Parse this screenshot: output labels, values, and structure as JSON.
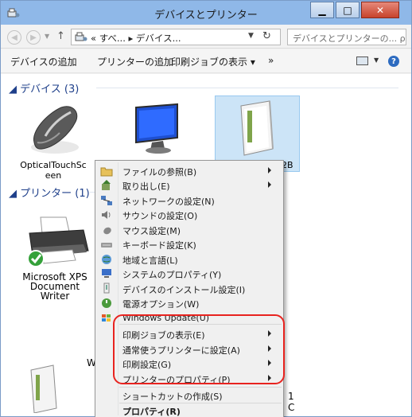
{
  "window": {
    "title": "デバイスとプリンター"
  },
  "nav": {
    "address_text": "« すべ... ▸ デバイス...",
    "search_placeholder": "デバイスとプリンターの... ρ"
  },
  "commands": {
    "add_device": "デバイスの追加",
    "add_printer": "プリンターの追加",
    "print_jobs": "印刷ジョブの表示 ▾",
    "more": "»"
  },
  "groups": {
    "devices": "◢ デバイス (3)",
    "printers": "◢ プリンター (1)"
  },
  "devices": [
    {
      "line1": "OpticalTouchSc",
      "line2": "een",
      "icon": "mouse-icon"
    },
    {
      "line1": "",
      "line2": "",
      "icon": "monitor-icon"
    },
    {
      "line1": "2B",
      "line2": "",
      "icon": "external-drive-icon"
    }
  ],
  "printers": [
    {
      "line1": "Microsoft XPS",
      "line2": "Document",
      "line3": "Writer",
      "icon": "printer-icon"
    }
  ],
  "bottom_device": {
    "label": "W",
    "icon": "external-drive-icon"
  },
  "peek_text": {
    "a": "1",
    "b": "C"
  },
  "context_menu": {
    "items": [
      {
        "label": "ファイルの参照(B)",
        "icon": "folder-icon",
        "submenu": true
      },
      {
        "label": "取り出し(E)",
        "icon": "eject-icon",
        "submenu": true
      },
      {
        "label": "ネットワークの設定(N)",
        "icon": "network-icon",
        "submenu": false
      },
      {
        "label": "サウンドの設定(O)",
        "icon": "speaker-icon",
        "submenu": false
      },
      {
        "label": "マウス設定(M)",
        "icon": "mouse-icon",
        "submenu": false
      },
      {
        "label": "キーボード設定(K)",
        "icon": "keyboard-icon",
        "submenu": false
      },
      {
        "label": "地域と言語(L)",
        "icon": "globe-icon",
        "submenu": false
      },
      {
        "label": "システムのプロパティ(Y)",
        "icon": "computer-icon",
        "submenu": false
      },
      {
        "label": "デバイスのインストール設定(I)",
        "icon": "device-install-icon",
        "submenu": false
      },
      {
        "label": "電源オプション(W)",
        "icon": "power-icon",
        "submenu": false
      },
      {
        "label": "Windows Update(U)",
        "icon": "windows-update-icon",
        "submenu": false
      },
      {
        "label": "印刷ジョブの表示(E)",
        "icon": "",
        "submenu": true
      },
      {
        "label": "通常使うプリンターに設定(A)",
        "icon": "",
        "submenu": true
      },
      {
        "label": "印刷設定(G)",
        "icon": "",
        "submenu": true
      },
      {
        "label": "プリンターのプロパティ(P)",
        "icon": "",
        "submenu": true
      },
      {
        "label": "ショートカットの作成(S)",
        "icon": "",
        "submenu": false
      },
      {
        "label": "プロパティ(R)",
        "icon": "",
        "submenu": false
      }
    ]
  },
  "colors": {
    "highlight": "#e8231f",
    "titlebar": "#8fb8e8",
    "selection": "#cce4f7"
  }
}
